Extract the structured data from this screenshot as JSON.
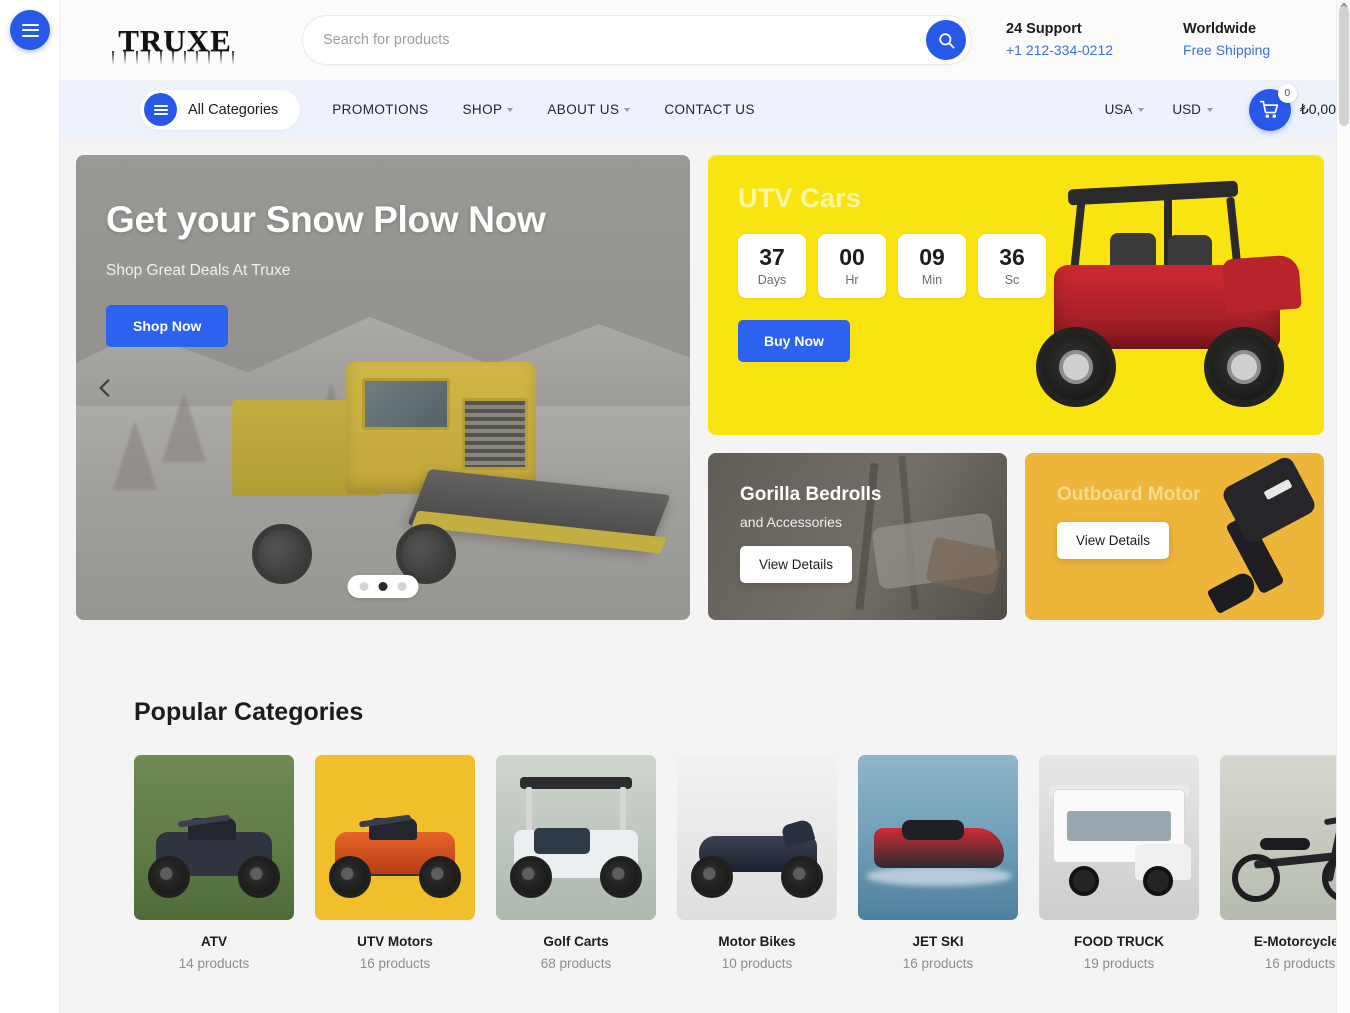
{
  "rail": {
    "menu_icon": "hamburger-icon"
  },
  "header": {
    "logo": "TRUXE",
    "search": {
      "placeholder": "Search for products",
      "value": "",
      "icon": "search-icon"
    },
    "support": {
      "title": "24 Support",
      "phone": "+1 212-334-0212"
    },
    "shipping": {
      "title": "Worldwide",
      "sub": "Free Shipping"
    }
  },
  "nav": {
    "all_categories": "All Categories",
    "links": [
      {
        "label": "PROMOTIONS",
        "has_caret": false
      },
      {
        "label": "SHOP",
        "has_caret": true
      },
      {
        "label": "ABOUT US",
        "has_caret": true
      },
      {
        "label": "CONTACT US",
        "has_caret": false
      }
    ],
    "country": "USA",
    "currency": "USD",
    "cart": {
      "count": "0",
      "total": "₺0,00",
      "icon": "cart-icon"
    }
  },
  "hero": {
    "title": "Get your Snow Plow Now",
    "subtitle": "Shop Great Deals At Truxe",
    "cta": "Shop Now",
    "prev_icon": "chevron-left-icon",
    "dots": [
      {
        "active": false
      },
      {
        "active": true
      },
      {
        "active": false
      }
    ]
  },
  "utv": {
    "title": "UTV Cars",
    "countdown": [
      {
        "value": "37",
        "unit": "Days"
      },
      {
        "value": "00",
        "unit": "Hr"
      },
      {
        "value": "09",
        "unit": "Min"
      },
      {
        "value": "36",
        "unit": "Sc"
      }
    ],
    "cta": "Buy Now"
  },
  "promos": [
    {
      "title": "Gorilla Bedrolls",
      "subtitle": "and Accessories",
      "cta": "View Details"
    },
    {
      "title": "Outboard Motor",
      "subtitle": "",
      "cta": "View Details"
    }
  ],
  "categories": {
    "heading": "Popular Categories",
    "items": [
      {
        "name": "ATV",
        "count": "14 products"
      },
      {
        "name": "UTV Motors",
        "count": "16 products"
      },
      {
        "name": "Golf Carts",
        "count": "68 products"
      },
      {
        "name": "Motor Bikes",
        "count": "10 products"
      },
      {
        "name": "JET SKI",
        "count": "16 products"
      },
      {
        "name": "FOOD TRUCK",
        "count": "19 products"
      },
      {
        "name": "E-Motorcycles",
        "count": "16 products"
      }
    ]
  },
  "colors": {
    "accent_blue": "#2759e8",
    "banner_yellow": "#f9e411",
    "promo_orange": "#edb63a",
    "nav_bg": "#eef2fd",
    "page_bg": "#f4f4f4"
  }
}
